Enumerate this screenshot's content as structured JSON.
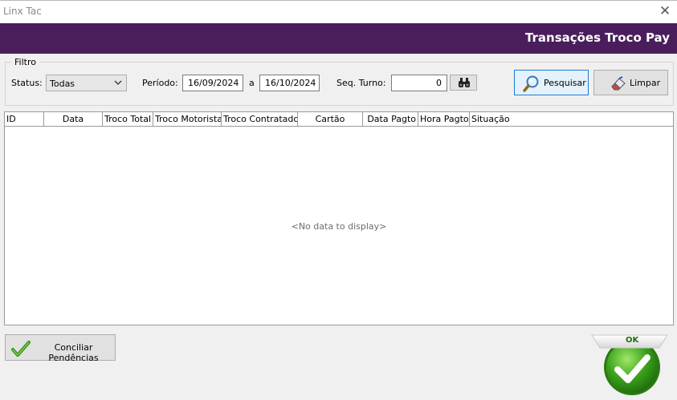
{
  "window": {
    "title": "Linx Tac",
    "close_glyph": "✕"
  },
  "header": {
    "title": "Transações Troco Pay",
    "color": "#4a1e5c"
  },
  "filter": {
    "legend": "Filtro",
    "status_label": "Status:",
    "status_value": "Todas",
    "period_label": "Período:",
    "date_from": "16/09/2024",
    "date_sep": "a",
    "date_to": "16/10/2024",
    "seq_label": "Seq. Turno:",
    "seq_value": "0"
  },
  "buttons": {
    "search": "Pesquisar",
    "clear": "Limpar",
    "conciliar": "Conciliar Pendências",
    "ok": "OK"
  },
  "grid": {
    "columns": [
      "ID",
      "Data",
      "Troco Total",
      "Troco Motorista",
      "Troco Contratado",
      "Cartão",
      "Data Pagto",
      "Hora Pagto",
      "Situação"
    ],
    "empty_text": "<No data to display>"
  },
  "icons": {
    "search": "magnifier-icon",
    "binoculars": "binoculars-icon",
    "clear": "eraser-icon",
    "conciliar": "checkmark-icon",
    "ok": "ok-checkmark-icon"
  },
  "colors": {
    "accent_green": "#3c9a1e",
    "ok_text": "#1a6e12"
  }
}
